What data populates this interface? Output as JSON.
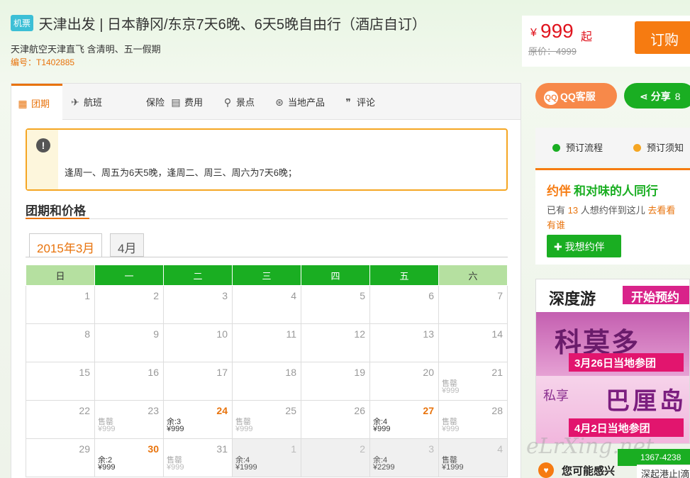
{
  "header": {
    "badge": "机票",
    "title": "天津出发 | 日本静冈/东京7天6晚、6天5晚自由行（酒店自订）",
    "subtitle": "天津航空天津直飞 含清明、五一假期",
    "code": "编号：T1402885"
  },
  "price": {
    "currency": "¥",
    "value": "999",
    "suffix": "起",
    "original": "原价：4999",
    "order_label": "订购"
  },
  "tabs": [
    {
      "label": "团期",
      "icon": "calendar-icon",
      "glyph": "▦"
    },
    {
      "label": "航班",
      "icon": "airplane-icon",
      "glyph": "✈"
    },
    {
      "label": "保险",
      "icon": "shield-icon",
      "glyph": ""
    },
    {
      "label": "费用",
      "icon": "wallet-icon",
      "glyph": "▤"
    },
    {
      "label": "景点",
      "icon": "map-pin-icon",
      "glyph": "⚲"
    },
    {
      "label": "当地产品",
      "icon": "location-icon",
      "glyph": "⊛"
    },
    {
      "label": "评论",
      "icon": "quote-icon",
      "glyph": "❞"
    }
  ],
  "notice": {
    "icon": "warning-icon",
    "glyph": "!",
    "text": "逢周一、周五为6天5晚，逢周二、周三、周六为7天6晚；"
  },
  "section_title": "团期和价格",
  "month_tabs": [
    "2015年3月",
    "4月"
  ],
  "weekdays": [
    "日",
    "一",
    "二",
    "三",
    "四",
    "五",
    "六"
  ],
  "calendar": [
    [
      {
        "d": "1"
      },
      {
        "d": "2"
      },
      {
        "d": "3"
      },
      {
        "d": "4"
      },
      {
        "d": "5"
      },
      {
        "d": "6"
      },
      {
        "d": "7"
      }
    ],
    [
      {
        "d": "8"
      },
      {
        "d": "9"
      },
      {
        "d": "10"
      },
      {
        "d": "11"
      },
      {
        "d": "12"
      },
      {
        "d": "13"
      },
      {
        "d": "14"
      }
    ],
    [
      {
        "d": "15"
      },
      {
        "d": "16"
      },
      {
        "d": "17"
      },
      {
        "d": "18"
      },
      {
        "d": "19"
      },
      {
        "d": "20"
      },
      {
        "d": "21",
        "s1": "售罄",
        "s2": "¥999"
      }
    ],
    [
      {
        "d": "22"
      },
      {
        "d": "23",
        "s1": "售罄",
        "s2": "¥999"
      },
      {
        "d": "24",
        "hl": true,
        "s1": "余:3",
        "s2": "¥999",
        "av": true
      },
      {
        "d": "25",
        "s1": "售罄",
        "s2": "¥999"
      },
      {
        "d": "26"
      },
      {
        "d": "27",
        "hl": true,
        "s1": "余:4",
        "s2": "¥999",
        "av": true
      },
      {
        "d": "28",
        "s1": "售罄",
        "s2": "¥999"
      }
    ],
    [
      {
        "d": "29"
      },
      {
        "d": "30",
        "hl": true,
        "s1": "余:2",
        "s2": "¥999",
        "av": true
      },
      {
        "d": "31",
        "s1": "售罄",
        "s2": "¥999"
      },
      {
        "d": "1",
        "next": true,
        "s1": "余:4",
        "s2": "¥1999"
      },
      {
        "d": "2",
        "next": true
      },
      {
        "d": "3",
        "next": true,
        "s1": "余:4",
        "s2": "¥2299"
      },
      {
        "d": "4",
        "next": true,
        "s1": "售罄",
        "s2": "¥1999"
      }
    ]
  ],
  "right": {
    "qq_label": "QQ客服",
    "qq_icon_text": "QQ",
    "share_label": "分享",
    "share_count": "8",
    "flow": [
      {
        "label": "预订流程",
        "color": "#1aae22"
      },
      {
        "label": "预订须知",
        "color": "#f5a623"
      }
    ],
    "yueban": {
      "logo": "约伴",
      "tagline": "和对味的人同行",
      "line_pre": "已有",
      "count": "13",
      "line_mid": "人想约伴到这儿",
      "link": "去看看",
      "link2": "有谁",
      "button": "✚ 我想约伴"
    },
    "ad": {
      "brand": "深度游",
      "start": "开始预约",
      "headline1": "科莫多",
      "date1": "3月26日当地参团",
      "sx": "私享",
      "headline2": "巴厘岛",
      "date2": "4月2日当地参团"
    },
    "interest": "您可能感兴",
    "phone": "1367-4238",
    "phone_sub": "深起港止|滴"
  },
  "colors": {
    "accent": "#e8730c",
    "green": "#1aae22",
    "price_red": "#e0141e"
  }
}
